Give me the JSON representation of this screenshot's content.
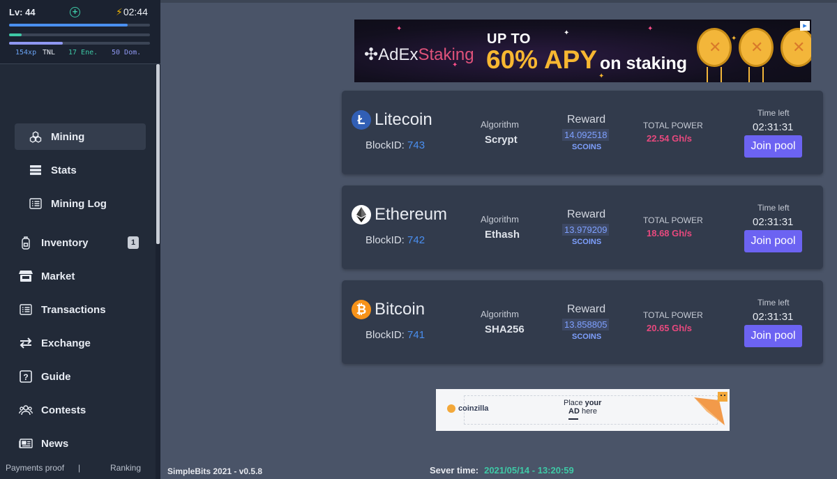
{
  "player": {
    "level": "Lv: 44",
    "energy_time": "02:44",
    "xp_tnl": "154xp",
    "tnl_label": "TNL",
    "energy": "17 Ene.",
    "dom": "50 Dom.",
    "xp_progress": 0.84,
    "energy_progress": 0.09,
    "dom_progress": 0.38,
    "colors": {
      "xp": "#4a8ff0",
      "energy": "#3ec9a6",
      "dom": "#8f98f2"
    }
  },
  "sidebar": {
    "items": [
      {
        "label": "Mining",
        "icon": "cubes-icon",
        "active": true
      },
      {
        "label": "Stats",
        "icon": "server-icon"
      },
      {
        "label": "Mining Log",
        "icon": "list-icon"
      },
      {
        "label": "Inventory",
        "icon": "backpack-icon",
        "badge": "1"
      },
      {
        "label": "Market",
        "icon": "store-icon"
      },
      {
        "label": "Transactions",
        "icon": "list-icon"
      },
      {
        "label": "Exchange",
        "icon": "exchange-icon"
      },
      {
        "label": "Guide",
        "icon": "question-icon"
      },
      {
        "label": "Contests",
        "icon": "users-icon"
      },
      {
        "label": "News",
        "icon": "newspaper-icon"
      }
    ],
    "footer": {
      "payments": "Payments proof",
      "separator": "|",
      "ranking": "Ranking"
    }
  },
  "ads": {
    "top": {
      "brand": "AdEx",
      "brand_suffix": "Staking",
      "line1": "UP TO",
      "line2": "60% APY",
      "line3": "on staking"
    },
    "bottom": {
      "brand": "coinzilla",
      "line1a": "Place ",
      "line1b": "your",
      "line2a": "AD",
      "line2b": " here"
    }
  },
  "pools": [
    {
      "coin": "Litecoin",
      "icon": "litecoin-icon",
      "block_label": "BlockID:",
      "block_id": "743",
      "algorithm_label": "Algorithm",
      "algorithm": "Scrypt",
      "reward_label": "Reward",
      "reward": "14.092518",
      "reward_unit": "SCOINS",
      "power_label": "TOTAL POWER",
      "power": "22.54 Gh/s",
      "time_label": "Time left",
      "time_left": "02:31:31",
      "join_label": "Join pool"
    },
    {
      "coin": "Ethereum",
      "icon": "ethereum-icon",
      "block_label": "BlockID:",
      "block_id": "742",
      "algorithm_label": "Algorithm",
      "algorithm": "Ethash",
      "reward_label": "Reward",
      "reward": "13.979209",
      "reward_unit": "SCOINS",
      "power_label": "TOTAL POWER",
      "power": "18.68 Gh/s",
      "time_label": "Time left",
      "time_left": "02:31:31",
      "join_label": "Join pool"
    },
    {
      "coin": "Bitcoin",
      "icon": "bitcoin-icon",
      "block_label": "BlockID:",
      "block_id": "741",
      "algorithm_label": "Algorithm",
      "algorithm": "SHA256",
      "reward_label": "Reward",
      "reward": "13.858805",
      "reward_unit": "SCOINS",
      "power_label": "TOTAL POWER",
      "power": "20.65 Gh/s",
      "time_label": "Time left",
      "time_left": "02:31:31",
      "join_label": "Join pool"
    }
  ],
  "footer": {
    "version": "SimpleBits 2021 - v0.5.8",
    "server_label": "Sever time:",
    "server_time": "2021/05/14 - 13:20:59"
  }
}
